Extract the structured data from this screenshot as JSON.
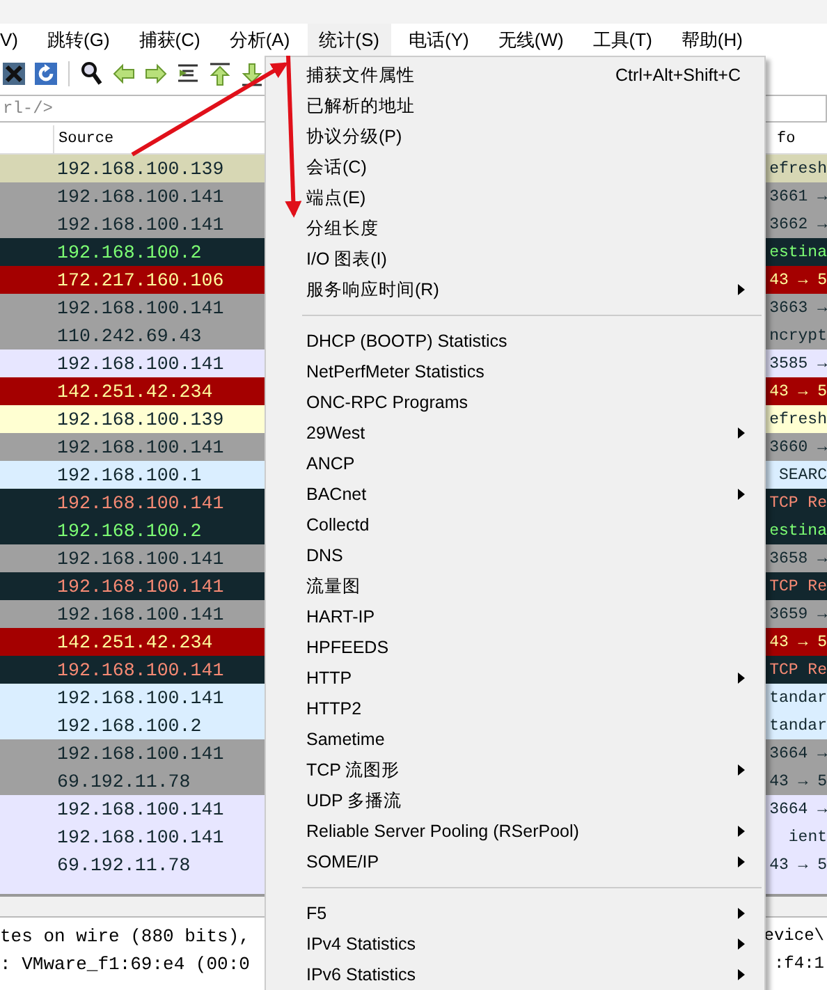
{
  "menubar": [
    {
      "label": "V)",
      "selected": false
    },
    {
      "label": "跳转(G)",
      "selected": false
    },
    {
      "label": "捕获(C)",
      "selected": false
    },
    {
      "label": "分析(A)",
      "selected": false
    },
    {
      "label": "统计(S)",
      "selected": true
    },
    {
      "label": "电话(Y)",
      "selected": false
    },
    {
      "label": "无线(W)",
      "selected": false
    },
    {
      "label": "工具(T)",
      "selected": false
    },
    {
      "label": "帮助(H)",
      "selected": false
    }
  ],
  "filter": {
    "placeholder": "rl-/>"
  },
  "columns": [
    "Source",
    "fo"
  ],
  "packets": [
    {
      "source": "192.168.100.139",
      "info": "efresh",
      "kind": "khaki"
    },
    {
      "source": "192.168.100.141",
      "info": "3661 →",
      "kind": "gray"
    },
    {
      "source": "192.168.100.141",
      "info": "3662 →",
      "kind": "gray"
    },
    {
      "source": "192.168.100.2",
      "info": "estina",
      "kind": "dark-green"
    },
    {
      "source": "172.217.160.106",
      "info": "43 → 5",
      "kind": "red"
    },
    {
      "source": "192.168.100.141",
      "info": "3663 →",
      "kind": "gray"
    },
    {
      "source": "110.242.69.43",
      "info": "ncrypt",
      "kind": "gray"
    },
    {
      "source": "192.168.100.141",
      "info": "3585 →",
      "kind": "lavender"
    },
    {
      "source": "142.251.42.234",
      "info": "43 → 5",
      "kind": "red"
    },
    {
      "source": "192.168.100.139",
      "info": "efresh",
      "kind": "yellow"
    },
    {
      "source": "192.168.100.141",
      "info": "3660 →",
      "kind": "gray"
    },
    {
      "source": "192.168.100.1",
      "info": "SEARC",
      "kind": "blue"
    },
    {
      "source": "192.168.100.141",
      "info": "TCP Re",
      "kind": "dark-red"
    },
    {
      "source": "192.168.100.2",
      "info": "estina",
      "kind": "dark-green"
    },
    {
      "source": "192.168.100.141",
      "info": "3658 →",
      "kind": "gray"
    },
    {
      "source": "192.168.100.141",
      "info": "TCP Re",
      "kind": "dark-red"
    },
    {
      "source": "192.168.100.141",
      "info": "3659 →",
      "kind": "gray"
    },
    {
      "source": "142.251.42.234",
      "info": "43 → 5",
      "kind": "red"
    },
    {
      "source": "192.168.100.141",
      "info": "TCP Re",
      "kind": "dark-red"
    },
    {
      "source": "192.168.100.141",
      "info": "tandar",
      "kind": "blue"
    },
    {
      "source": "192.168.100.2",
      "info": "tandar",
      "kind": "blue"
    },
    {
      "source": "192.168.100.141",
      "info": "3664 →",
      "kind": "gray"
    },
    {
      "source": "69.192.11.78",
      "info": "43 → 5",
      "kind": "gray"
    },
    {
      "source": "192.168.100.141",
      "info": "3664 →",
      "kind": "lavender"
    },
    {
      "source": "192.168.100.141",
      "info": "ient",
      "kind": "lavender"
    },
    {
      "source": "69.192.11.78",
      "info": "43 → 5",
      "kind": "lavender"
    }
  ],
  "details": [
    {
      "left": "tes on wire (880 bits),",
      "right": "evice\\"
    },
    {
      "left": ": VMware_f1:69:e4 (00:0",
      "right": ":f4:1"
    }
  ],
  "menu": [
    {
      "kind": "item",
      "label": "捕获文件属性",
      "shortcut": "Ctrl+Alt+Shift+C",
      "submenu": false
    },
    {
      "kind": "item",
      "label": "已解析的地址",
      "submenu": false
    },
    {
      "kind": "item",
      "label": "协议分级(P)",
      "submenu": false
    },
    {
      "kind": "item",
      "label": "会话(C)",
      "submenu": false
    },
    {
      "kind": "item",
      "label": "端点(E)",
      "submenu": false
    },
    {
      "kind": "item",
      "label": "分组长度",
      "submenu": false
    },
    {
      "kind": "item",
      "label": "I/O 图表(I)",
      "submenu": false
    },
    {
      "kind": "item",
      "label": "服务响应时间(R)",
      "submenu": true
    },
    {
      "kind": "separator"
    },
    {
      "kind": "item",
      "label": "DHCP (BOOTP) Statistics",
      "submenu": false
    },
    {
      "kind": "item",
      "label": "NetPerfMeter Statistics",
      "submenu": false
    },
    {
      "kind": "item",
      "label": "ONC-RPC Programs",
      "submenu": false
    },
    {
      "kind": "item",
      "label": "29West",
      "submenu": true
    },
    {
      "kind": "item",
      "label": "ANCP",
      "submenu": false
    },
    {
      "kind": "item",
      "label": "BACnet",
      "submenu": true
    },
    {
      "kind": "item",
      "label": "Collectd",
      "submenu": false
    },
    {
      "kind": "item",
      "label": "DNS",
      "submenu": false
    },
    {
      "kind": "item",
      "label": "流量图",
      "submenu": false
    },
    {
      "kind": "item",
      "label": "HART-IP",
      "submenu": false
    },
    {
      "kind": "item",
      "label": "HPFEEDS",
      "submenu": false
    },
    {
      "kind": "item",
      "label": "HTTP",
      "submenu": true
    },
    {
      "kind": "item",
      "label": "HTTP2",
      "submenu": false
    },
    {
      "kind": "item",
      "label": "Sametime",
      "submenu": false
    },
    {
      "kind": "item",
      "label": "TCP 流图形",
      "submenu": true
    },
    {
      "kind": "item",
      "label": "UDP 多播流",
      "submenu": false
    },
    {
      "kind": "item",
      "label": "Reliable Server Pooling (RSerPool)",
      "submenu": true
    },
    {
      "kind": "item",
      "label": "SOME/IP",
      "submenu": true
    },
    {
      "kind": "separator"
    },
    {
      "kind": "item",
      "label": "F5",
      "submenu": true
    },
    {
      "kind": "item",
      "label": "IPv4 Statistics",
      "submenu": true
    },
    {
      "kind": "item",
      "label": "IPv6 Statistics",
      "submenu": true
    }
  ]
}
